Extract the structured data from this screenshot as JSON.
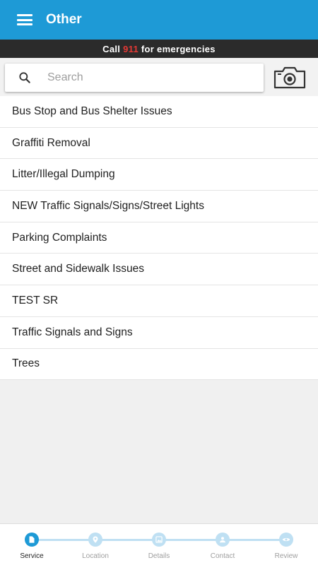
{
  "appbar": {
    "title": "Other",
    "menu_icon": "menu-icon"
  },
  "emergency": {
    "prefix": "Call ",
    "number": "911",
    "suffix": " for emergencies",
    "number_color": "#e53935"
  },
  "search": {
    "placeholder": "Search",
    "value": "",
    "icon": "search-icon",
    "camera_icon": "camera-icon"
  },
  "services": [
    "Bus Stop and Bus Shelter Issues",
    "Graffiti Removal",
    "Litter/Illegal Dumping",
    "NEW Traffic Signals/Signs/Street Lights",
    "Parking Complaints",
    "Street and Sidewalk Issues",
    "TEST SR",
    "Traffic Signals and Signs",
    "Trees"
  ],
  "steps": [
    {
      "label": "Service",
      "icon": "document-icon",
      "active": true
    },
    {
      "label": "Location",
      "icon": "location-pin-icon",
      "active": false
    },
    {
      "label": "Details",
      "icon": "image-icon",
      "active": false
    },
    {
      "label": "Contact",
      "icon": "person-icon",
      "active": false
    },
    {
      "label": "Review",
      "icon": "eye-icon",
      "active": false
    }
  ],
  "colors": {
    "primary": "#1e9ad6",
    "emergency_bar": "#2b2b2b",
    "step_inactive": "#bfe0f3"
  }
}
